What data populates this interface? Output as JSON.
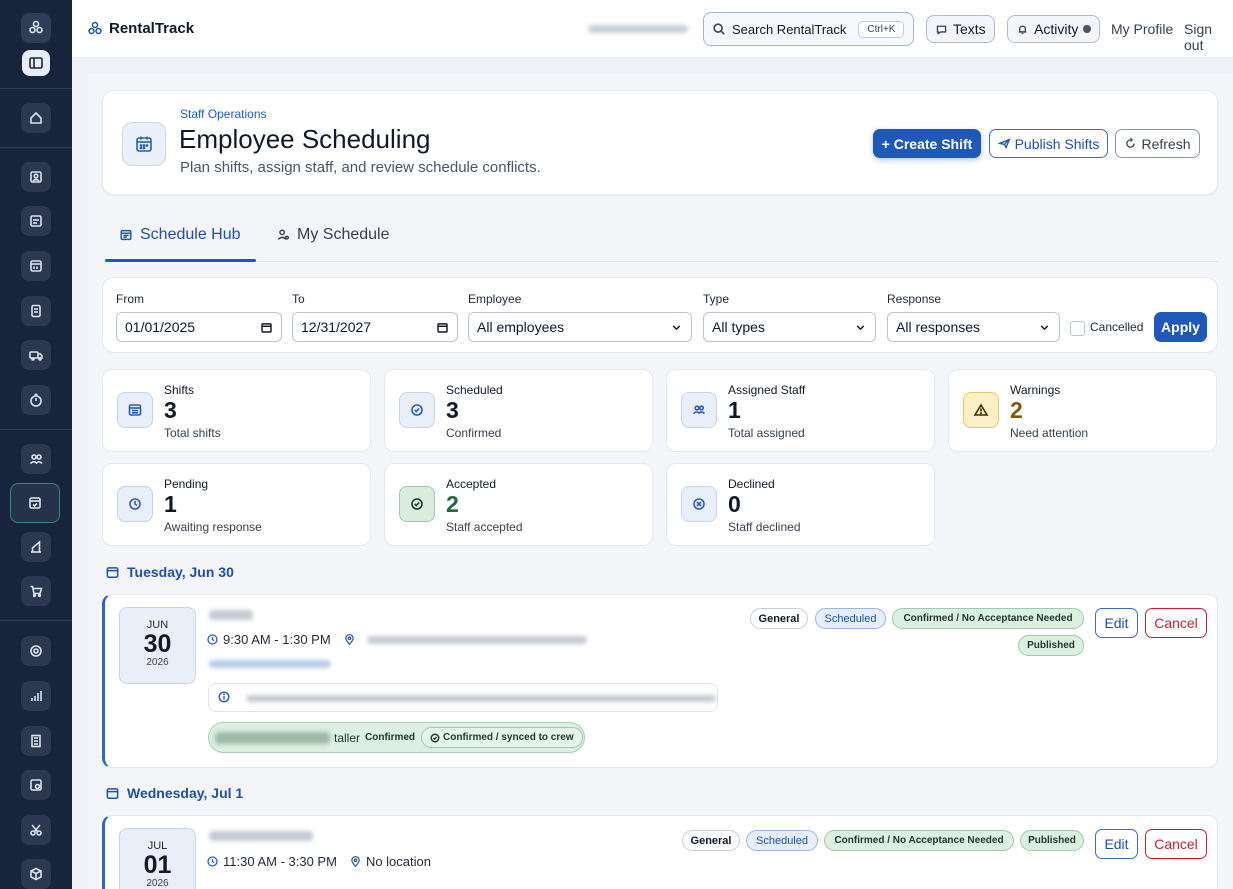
{
  "app": {
    "brand": "RentalTrack",
    "search_label": "Search RentalTrack",
    "search_shortcut": "Ctrl+K",
    "texts_label": "Texts",
    "activity_label": "Activity",
    "profile_label": "My Profile",
    "signout_label": "Sign out"
  },
  "header": {
    "eyebrow": "Staff Operations",
    "title": "Employee Scheduling",
    "subtitle": "Plan shifts, assign staff, and review schedule conflicts.",
    "create_label": "+ Create Shift",
    "publish_label": "Publish Shifts",
    "refresh_label": "Refresh"
  },
  "tabs": [
    {
      "label": "Schedule Hub",
      "active": true
    },
    {
      "label": "My Schedule",
      "active": false
    }
  ],
  "filters": {
    "from_label": "From",
    "from_value": "01/01/2025",
    "to_label": "To",
    "to_value": "12/31/2027",
    "employee_label": "Employee",
    "employee_value": "All employees",
    "type_label": "Type",
    "type_value": "All types",
    "response_label": "Response",
    "response_value": "All responses",
    "cancelled_label": "Cancelled",
    "apply_label": "Apply"
  },
  "stats": [
    {
      "label": "Shifts",
      "value": "3",
      "sub": "Total shifts",
      "icon": "calendar-grid-icon"
    },
    {
      "label": "Scheduled",
      "value": "3",
      "sub": "Confirmed",
      "icon": "check-circle-icon"
    },
    {
      "label": "Assigned Staff",
      "value": "1",
      "sub": "Total assigned",
      "icon": "users-icon"
    },
    {
      "label": "Warnings",
      "value": "2",
      "sub": "Need attention",
      "icon": "warning-icon",
      "accent": "#7a5a00"
    },
    {
      "label": "Pending",
      "value": "1",
      "sub": "Awaiting response",
      "icon": "clock-icon"
    },
    {
      "label": "Accepted",
      "value": "2",
      "sub": "Staff accepted",
      "icon": "check-circle-icon",
      "accent": "#1d6b3a"
    },
    {
      "label": "Declined",
      "value": "0",
      "sub": "Staff declined",
      "icon": "x-circle-icon"
    }
  ],
  "days": [
    {
      "heading": "Tuesday, Jun 30",
      "date_month": "JUN",
      "date_day": "30",
      "date_year": "2026",
      "time": "9:30 AM - 1:30 PM",
      "location": "",
      "badges": [
        "General",
        "Scheduled",
        "Confirmed / No Acceptance Needed",
        "Published"
      ],
      "assignee_role_suffix": "taller",
      "assignee_status": "Confirmed",
      "assignee_sync": "Confirmed / synced to crew",
      "edit_label": "Edit",
      "cancel_label": "Cancel"
    },
    {
      "heading": "Wednesday, Jul 1",
      "date_month": "JUL",
      "date_day": "01",
      "date_year": "2026",
      "time": "11:30 AM - 3:30 PM",
      "location": "No location",
      "badges": [
        "General",
        "Scheduled",
        "Confirmed / No Acceptance Needed",
        "Published"
      ],
      "edit_label": "Edit",
      "cancel_label": "Cancel"
    }
  ],
  "colors": {
    "sidebar": "#18243b",
    "primary": "#2058b8",
    "danger": "#c81e32",
    "success_bg": "#dcefe1"
  }
}
